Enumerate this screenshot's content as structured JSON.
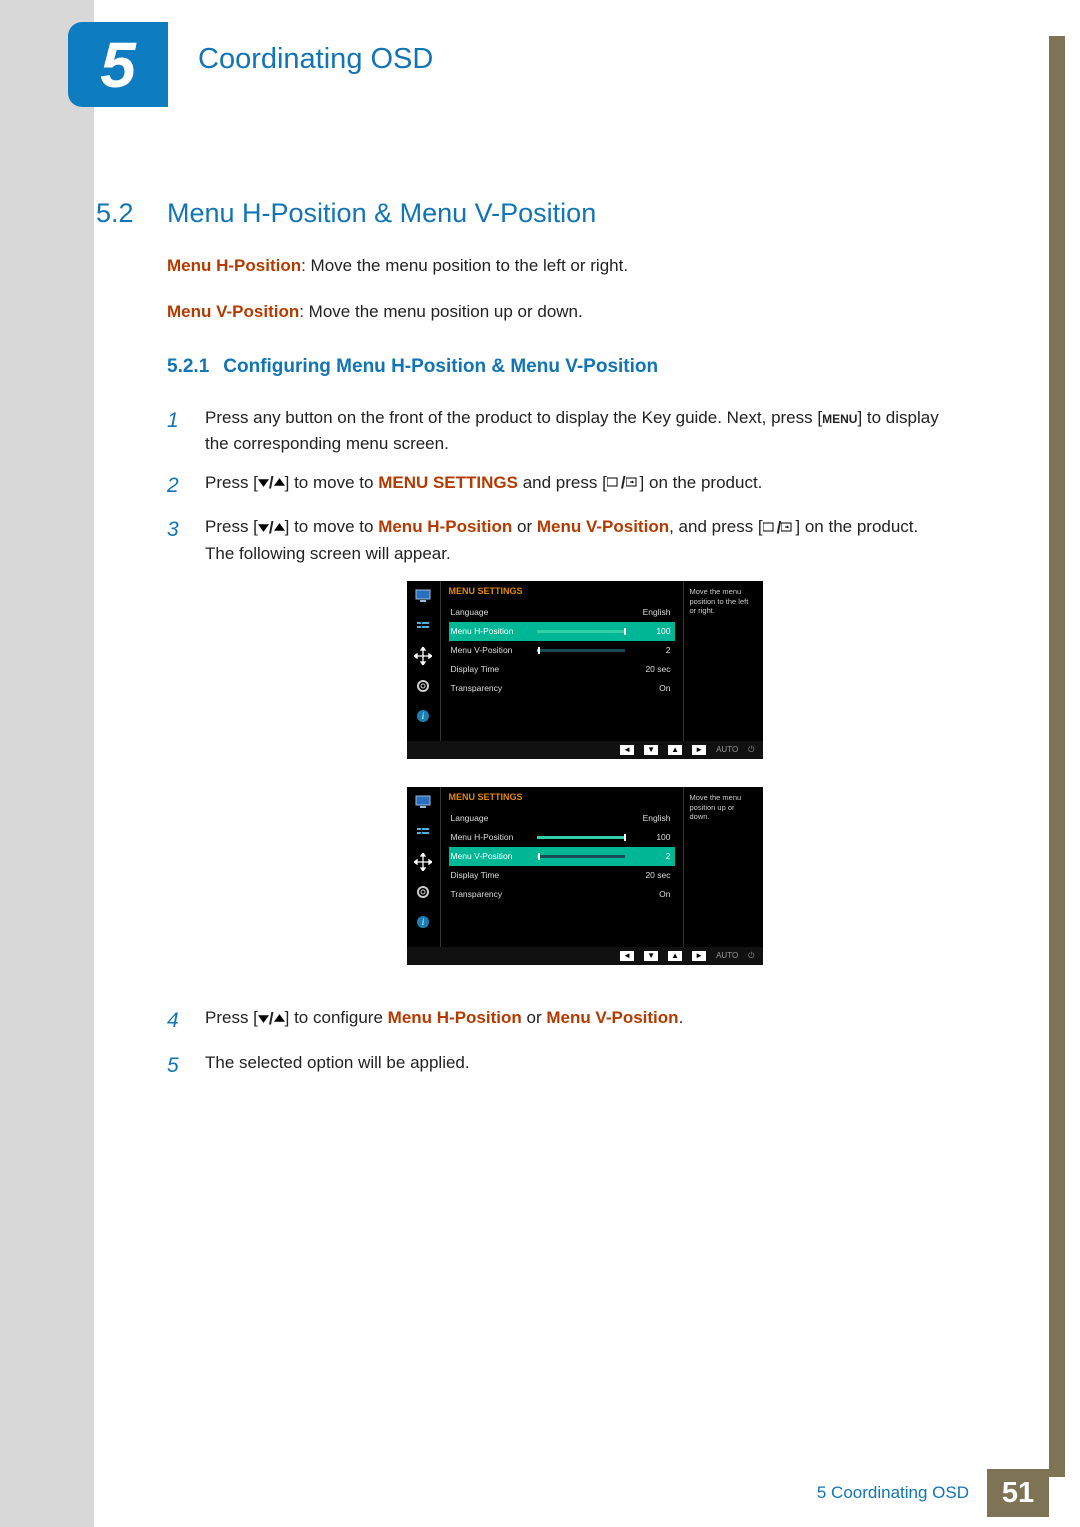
{
  "chapter": {
    "number": "5",
    "title": "Coordinating OSD"
  },
  "section": {
    "number": "5.2",
    "title": "Menu H-Position & Menu V-Position"
  },
  "desc": {
    "h_label": "Menu H-Position",
    "h_text": ": Move the menu position to the left or right.",
    "v_label": "Menu V-Position",
    "v_text": ": Move the menu position up or down."
  },
  "subsection": {
    "number": "5.2.1",
    "title": "Configuring Menu H-Position & Menu V-Position"
  },
  "steps": {
    "s1": "Press any button on the front of the product to display the Key guide. Next, press [",
    "s1_menu": "MENU",
    "s1_end": "] to display the corresponding menu screen.",
    "s2a": "Press [",
    "s2b": "] to move to ",
    "s2c": "MENU SETTINGS",
    "s2d": " and press [",
    "s2e": "] on the product.",
    "s3a": "Press [",
    "s3b": "] to move to ",
    "s3c": "Menu H-Position",
    "s3or": " or ",
    "s3d": "Menu V-Position",
    "s3e": ", and press [",
    "s3f": "] on the product.",
    "s3g": "The following screen will appear.",
    "s4a": "Press [",
    "s4b": "] to configure ",
    "s4c": "Menu H-Position",
    "s4or": " or ",
    "s4d": "Menu V-Position",
    "s4e": ".",
    "s5": "The selected option will be applied."
  },
  "osd": {
    "head": "MENU SETTINGS",
    "rows": {
      "language": "Language",
      "english": "English",
      "mhpos": "Menu H-Position",
      "mvpos": "Menu V-Position",
      "dtime": "Display Time",
      "trans": "Transparency"
    },
    "vals": {
      "h": "100",
      "v": "2",
      "time": "20 sec",
      "trans": "On"
    },
    "tip_h": "Move the menu position to the left or right.",
    "tip_v": "Move the menu position up or down.",
    "auto": "AUTO"
  },
  "footer": {
    "text": "5 Coordinating OSD",
    "page": "51"
  }
}
